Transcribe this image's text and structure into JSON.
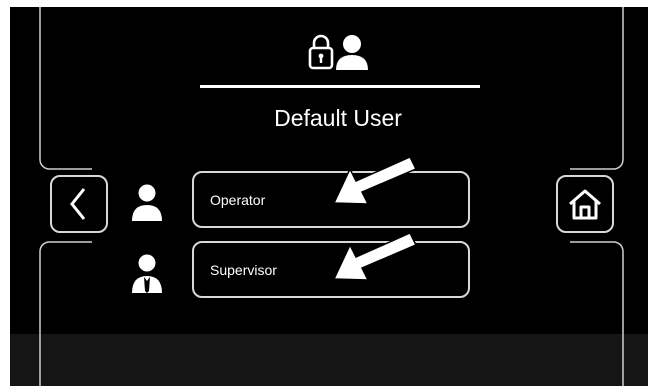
{
  "header": {
    "icons": [
      "lock-icon",
      "user-icon"
    ],
    "title": "Default User"
  },
  "navigation": {
    "back_icon": "chevron-left-icon",
    "home_icon": "home-icon"
  },
  "users": [
    {
      "label": "Operator",
      "icon": "operator-icon"
    },
    {
      "label": "Supervisor",
      "icon": "supervisor-icon"
    }
  ],
  "colors": {
    "background": "#000000",
    "foreground": "#ffffff",
    "outline": "#d8d8d8"
  }
}
